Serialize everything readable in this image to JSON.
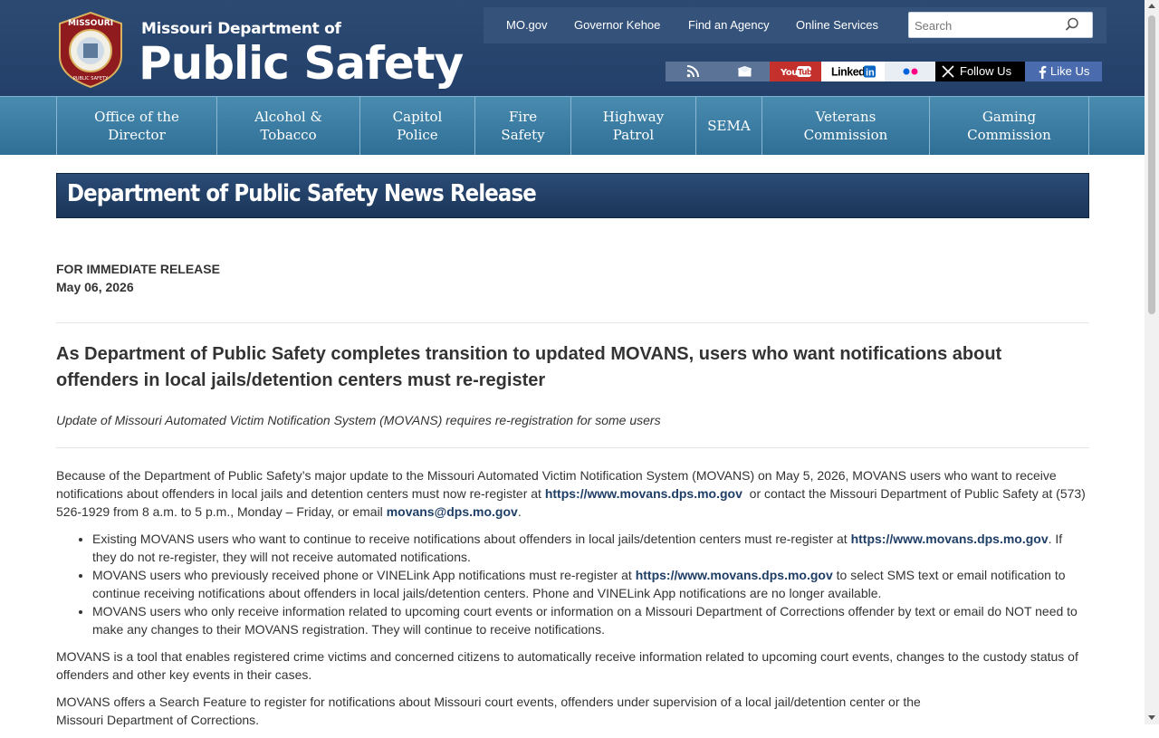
{
  "header": {
    "logo_line1": "Missouri Department of",
    "logo_line2": "Public Safety",
    "seal_alt": "Missouri Department of Public Safety seal"
  },
  "topnav": {
    "links": [
      "MO.gov",
      "Governor Kehoe",
      "Find an Agency",
      "Online Services"
    ],
    "search_placeholder": "Search"
  },
  "social": {
    "youtube": "You Tube",
    "linkedin": "Linked",
    "x_label": "Follow Us",
    "fb_label": "Like Us"
  },
  "mainnav": [
    {
      "l1": "Office of the",
      "l2": "Director"
    },
    {
      "l1": "Alcohol &",
      "l2": "Tobacco"
    },
    {
      "l1": "Capitol",
      "l2": "Police"
    },
    {
      "l1": "Fire",
      "l2": "Safety"
    },
    {
      "l1": "Highway",
      "l2": "Patrol"
    },
    {
      "l1": "SEMA",
      "l2": ""
    },
    {
      "l1": "Veterans",
      "l2": "Commission"
    },
    {
      "l1": "Gaming",
      "l2": "Commission"
    }
  ],
  "banner_title": "Department of Public Safety News Release",
  "release": {
    "label": "FOR IMMEDIATE RELEASE",
    "date": "May 06, 2026"
  },
  "headline": "As Department of Public Safety completes transition to updated MOVANS, users who want notifications about offenders in local jails/detention centers must re-register",
  "subhead": "Update of Missouri Automated Victim Notification System (MOVANS) requires re-registration for some users",
  "body": {
    "p1_a": "Because of the Department of Public Safety’s major update to the Missouri Automated Victim Notification System (MOVANS) on May 5, 2026, MOVANS users who want to receive notifications about offenders in local jails and detention centers must now re-register at ",
    "p1_link": "https://www.movans.dps.mo.gov",
    "p1_b": "  or contact the Missouri Department of Public Safety at (573) 526-1929 from 8 a.m. to 5 p.m., Monday – Friday, or email ",
    "p1_email": "movans@dps.mo.gov",
    "p1_c": ".",
    "li1_a": "Existing MOVANS users who want to continue to receive notifications about offenders in local jails/detention centers must re-register at ",
    "li1_link": "https://www.movans.dps.mo.gov",
    "li1_b": ". If they do not re-register, they will not receive automated notifications.",
    "li2_a": "MOVANS users who previously received phone or VINELink App notifications must re-register at ",
    "li2_link": "https://www.movans.dps.mo.gov",
    "li2_b": " to select SMS text or email notification to continue receiving notifications about offenders in local jails/detention centers. Phone and VINELink App notifications are no longer available.",
    "li3": "MOVANS users who only receive information related to upcoming court events or information on a Missouri Department of Corrections offender by text or email do NOT need to make any changes to their MOVANS registration. They will continue to receive notifications.",
    "p2": "MOVANS is a tool that enables registered crime victims and concerned citizens to automatically receive information related to upcoming court events, changes to the custody status of offenders and other key events in their cases.",
    "p3_a": "MOVANS offers a Search Feature to register for notifications about Missouri court events, offenders under supervision of a local jail/detention center or the",
    "p3_b": "Missouri Department of Corrections."
  }
}
